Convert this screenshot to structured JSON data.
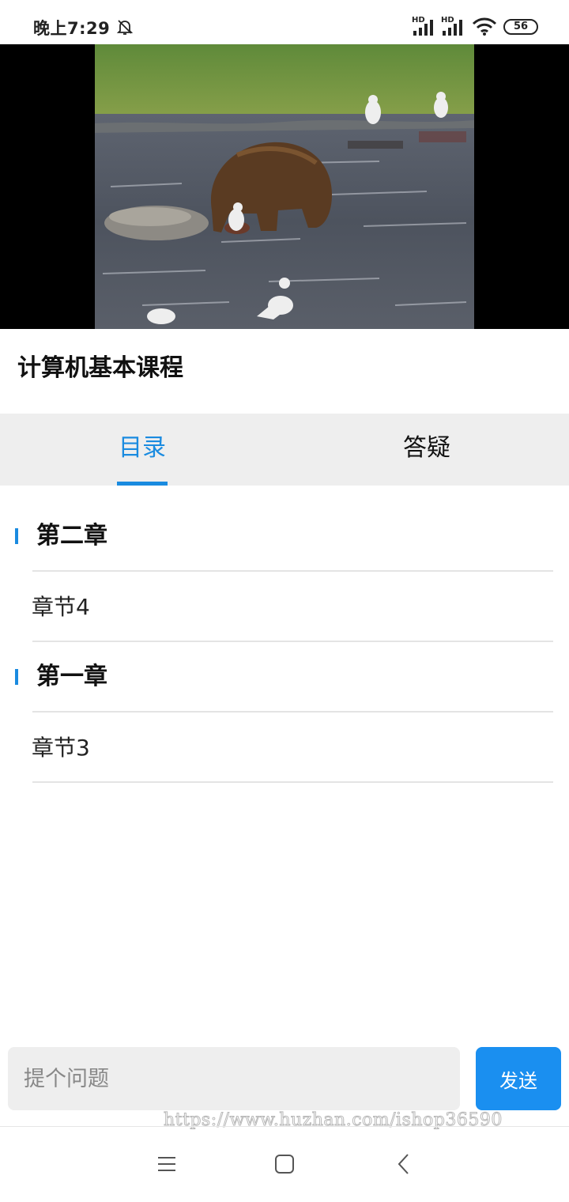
{
  "status_bar": {
    "time": "晚上7:29",
    "hd_1": "HD",
    "hd_2": "HD",
    "battery": "56",
    "icons": [
      "bell-off-icon",
      "signal-icon",
      "signal-icon",
      "wifi-icon",
      "battery-icon"
    ]
  },
  "video": {
    "description_icon": "video-player"
  },
  "course": {
    "title": "计算机基本课程"
  },
  "tabs": [
    {
      "label": "目录",
      "active": true
    },
    {
      "label": "答疑",
      "active": false
    }
  ],
  "catalog": [
    {
      "chapter": "第二章",
      "sections": [
        "章节4"
      ]
    },
    {
      "chapter": "第一章",
      "sections": [
        "章节3"
      ]
    }
  ],
  "question": {
    "placeholder": "提个问题",
    "value": "",
    "send_label": "发送"
  },
  "watermark": "https://www.huzhan.com/ishop36590",
  "nav_bar": {
    "icons": [
      "menu-icon",
      "home-icon",
      "back-icon"
    ]
  },
  "colors": {
    "accent": "#1a8be0",
    "send_button": "#1a8ff0",
    "tab_bg": "#eeeeee"
  }
}
